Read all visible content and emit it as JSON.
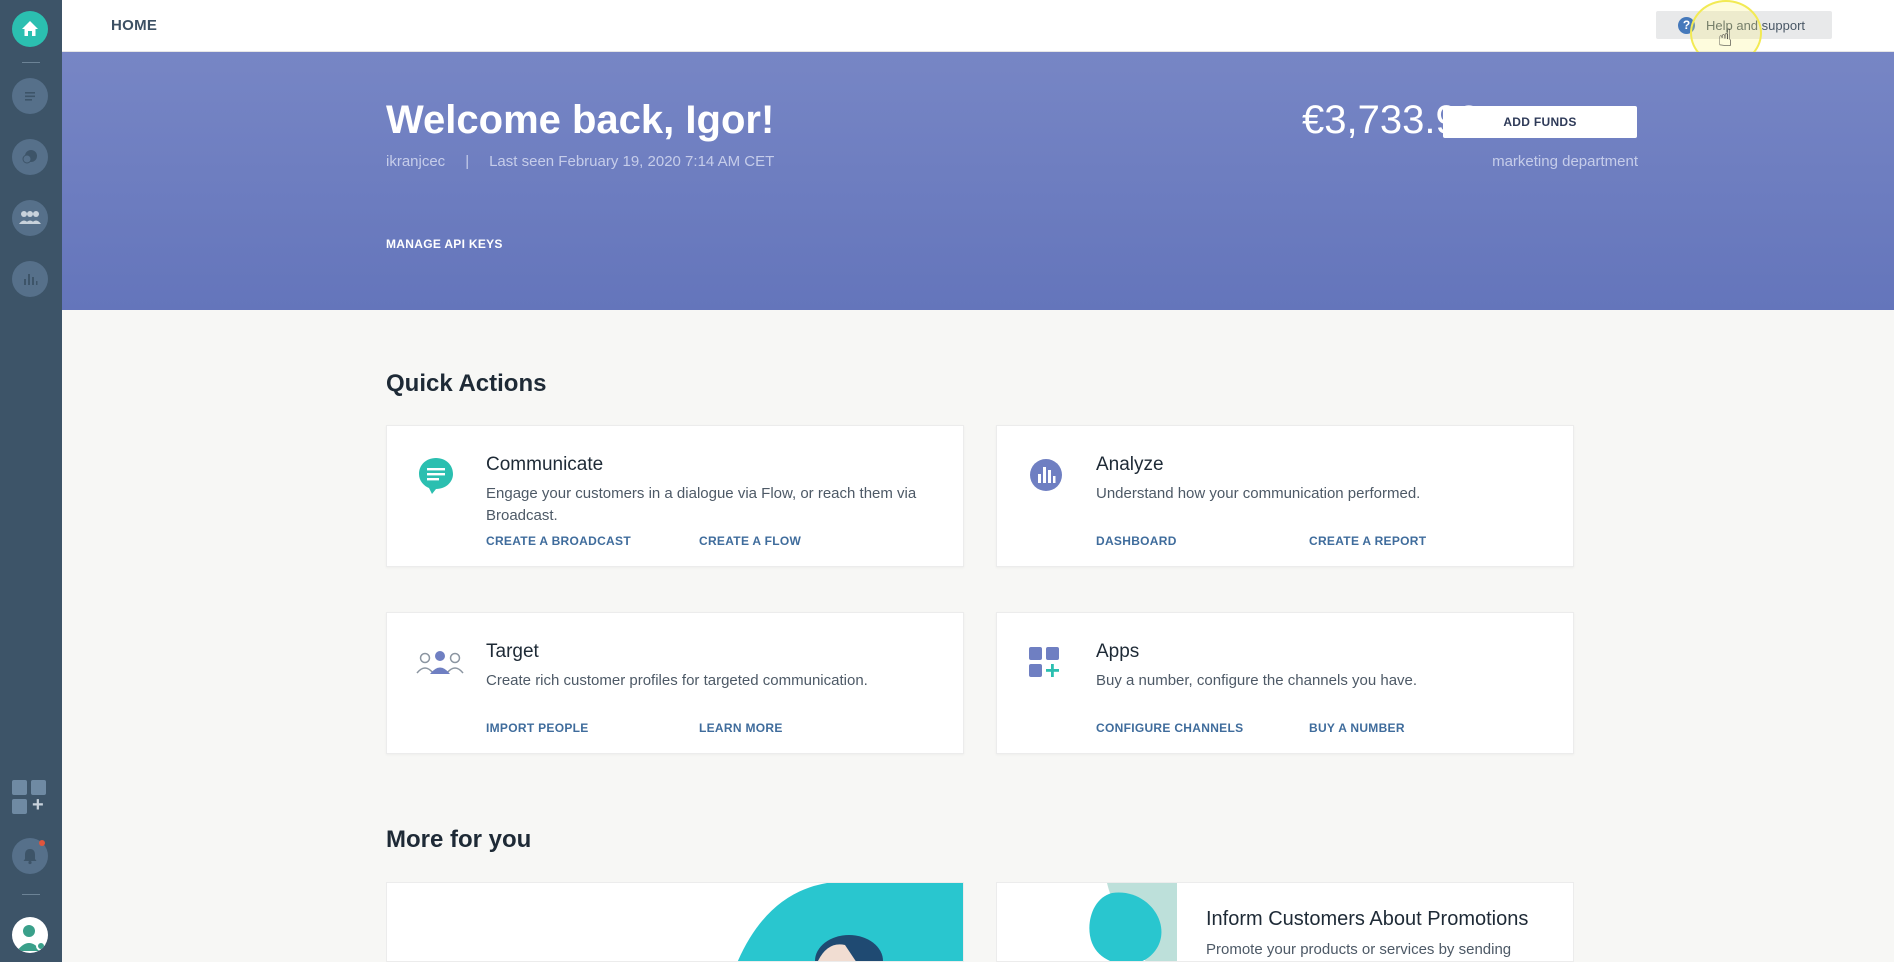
{
  "topbar": {
    "breadcrumb": "HOME",
    "help_label": "Help and support"
  },
  "hero": {
    "title": "Welcome back, Igor!",
    "username": "ikranjcec",
    "separator": "|",
    "last_seen": "Last seen February 19, 2020 7:14 AM CET",
    "balance": "€3,733.98",
    "add_funds_label": "ADD FUNDS",
    "department": "marketing department",
    "api_keys_label": "MANAGE API KEYS"
  },
  "quick_actions": {
    "title": "Quick Actions",
    "cards": [
      {
        "icon": "chat-bubble-icon",
        "title": "Communicate",
        "description": "Engage your customers in a dialogue via Flow, or reach them via Broadcast.",
        "links": [
          "CREATE A BROADCAST",
          "CREATE A FLOW"
        ]
      },
      {
        "icon": "analytics-icon",
        "title": "Analyze",
        "description": "Understand how your communication performed.",
        "links": [
          "DASHBOARD",
          "CREATE A REPORT"
        ]
      },
      {
        "icon": "people-icon",
        "title": "Target",
        "description": "Create rich customer profiles for targeted communication.",
        "links": [
          "IMPORT PEOPLE",
          "LEARN MORE"
        ]
      },
      {
        "icon": "apps-grid-icon",
        "title": "Apps",
        "description": "Buy a number, configure the channels you have.",
        "links": [
          "CONFIGURE CHANNELS",
          "BUY A NUMBER"
        ]
      }
    ]
  },
  "more_for_you": {
    "title": "More for you",
    "promo_title": "Inform Customers About Promotions",
    "promo_desc": "Promote your products or services by sending"
  },
  "colors": {
    "teal": "#2bbfb0",
    "hero": "#6f7fc2",
    "sidebar": "#3d5468",
    "link": "#3f6c9c"
  }
}
